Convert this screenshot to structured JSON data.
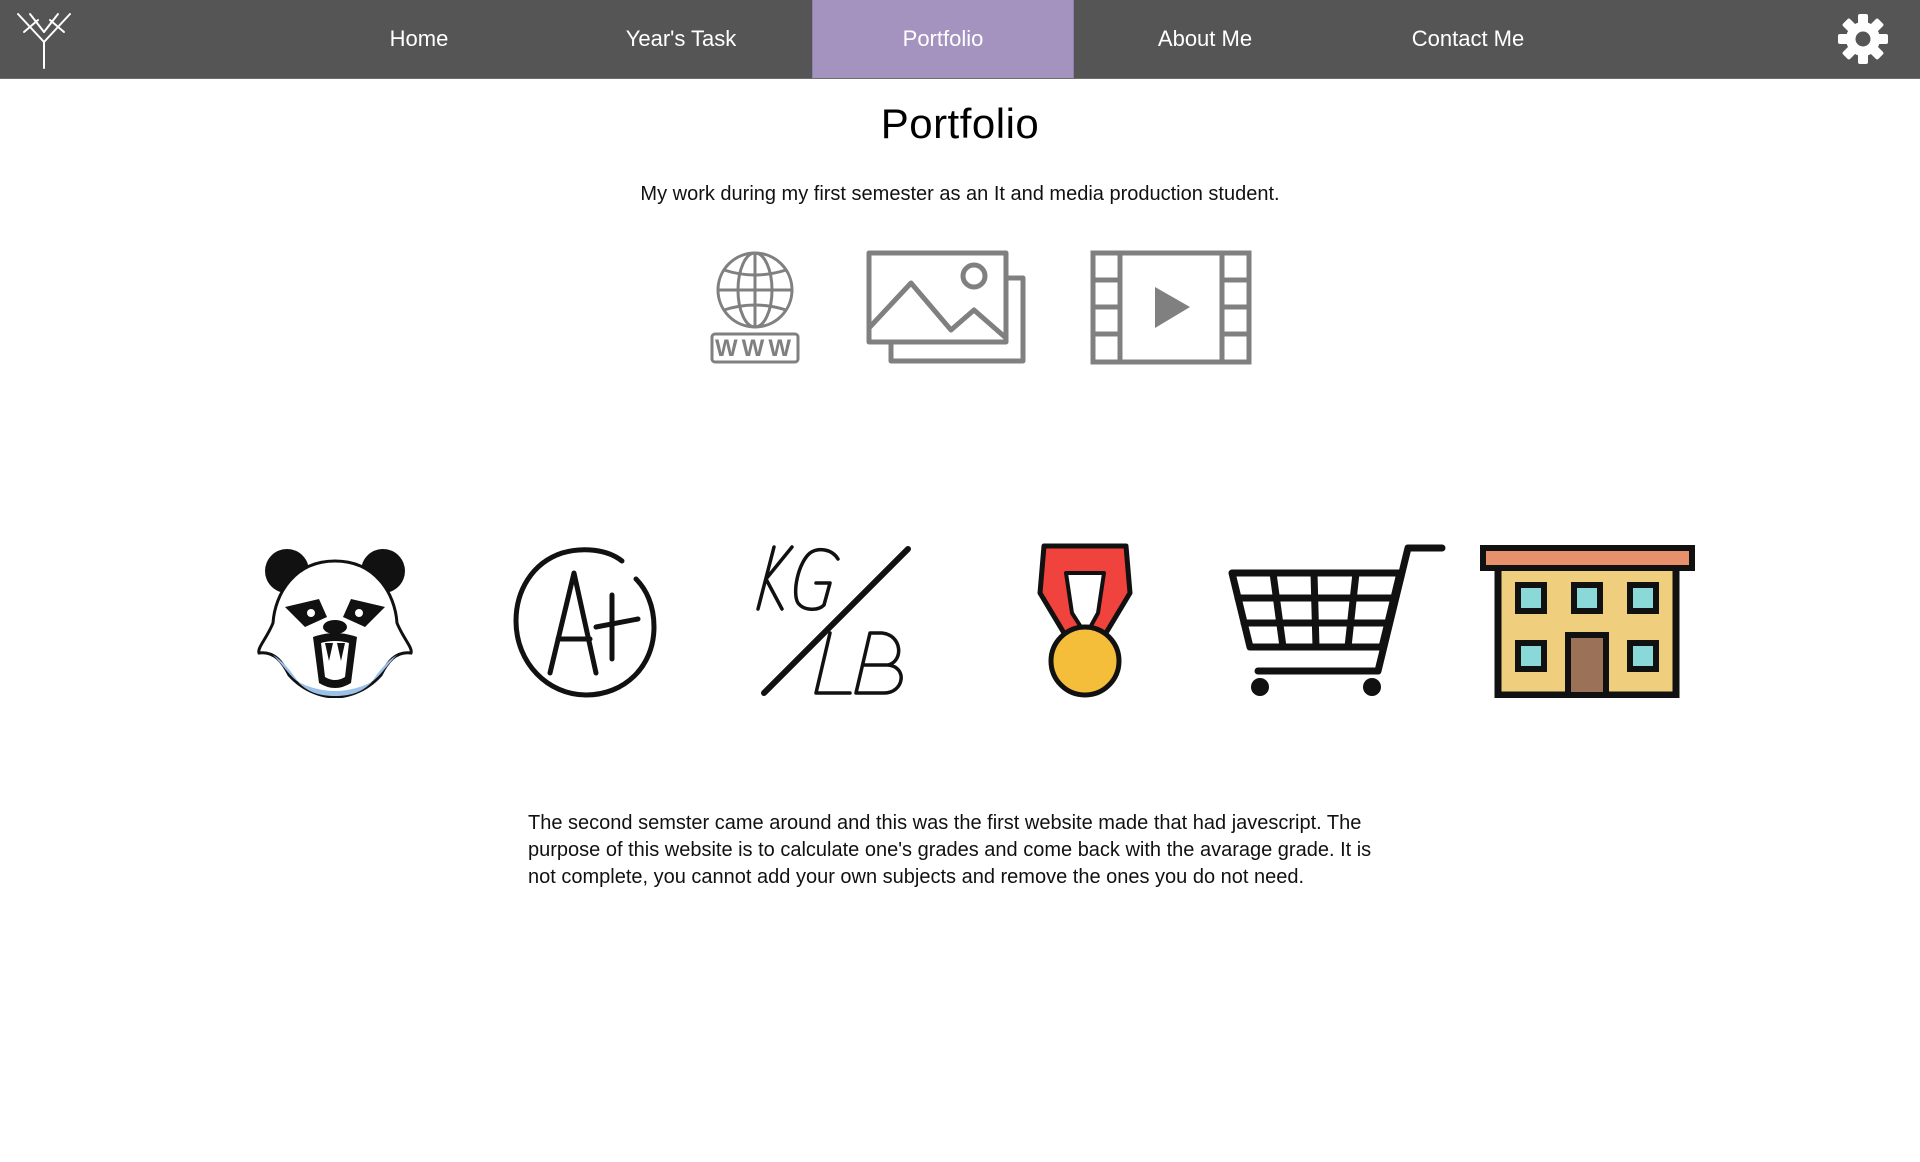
{
  "nav": {
    "items": [
      {
        "label": "Home"
      },
      {
        "label": "Year's Task"
      },
      {
        "label": "Portfolio"
      },
      {
        "label": "About Me"
      },
      {
        "label": "Contact Me"
      }
    ],
    "active": "Portfolio",
    "active_color": "#a493bf",
    "bar_color": "#555555"
  },
  "page": {
    "title": "Portfolio",
    "subtitle": "My work during my first semester as an It and media production student."
  },
  "categories": [
    {
      "icon": "globe-www-icon"
    },
    {
      "icon": "images-icon"
    },
    {
      "icon": "video-film-icon"
    }
  ],
  "projects": [
    {
      "icon": "panda-logo-icon"
    },
    {
      "icon": "a-plus-grade-icon"
    },
    {
      "icon": "kg-lb-converter-icon",
      "text_top": "KG",
      "text_bottom": "LB"
    },
    {
      "icon": "medal-icon"
    },
    {
      "icon": "shopping-cart-icon"
    },
    {
      "icon": "building-icon"
    }
  ],
  "description": "The second semster came around and this was the first website made that had javescript. The purpose of this website is to calculate one's grades and come back with the avarage grade. It is not complete, you cannot add your own subjects and remove the ones you do not need."
}
